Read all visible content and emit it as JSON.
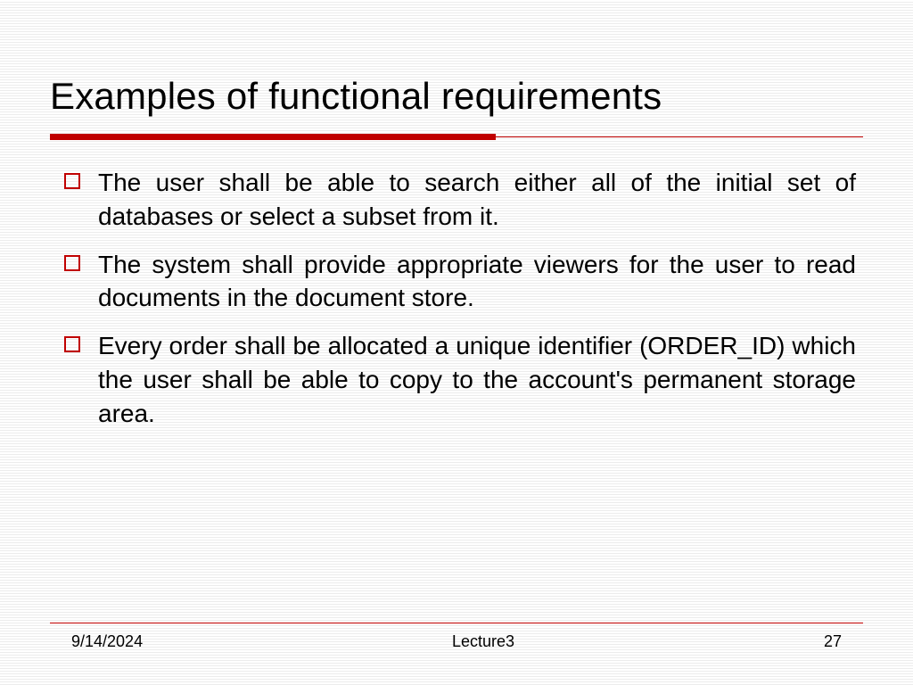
{
  "title": "Examples of functional requirements",
  "bullets": [
    "The user shall be able to search either all of the initial set of databases or select a subset from it.",
    "The system shall provide appropriate viewers for the user to read documents in the document store.",
    "Every order shall be allocated a unique identifier (ORDER_ID) which the user shall be able to copy to the account's permanent storage area."
  ],
  "footer": {
    "date": "9/14/2024",
    "center": "Lecture3",
    "page": "27"
  },
  "colors": {
    "accent": "#c00000"
  }
}
